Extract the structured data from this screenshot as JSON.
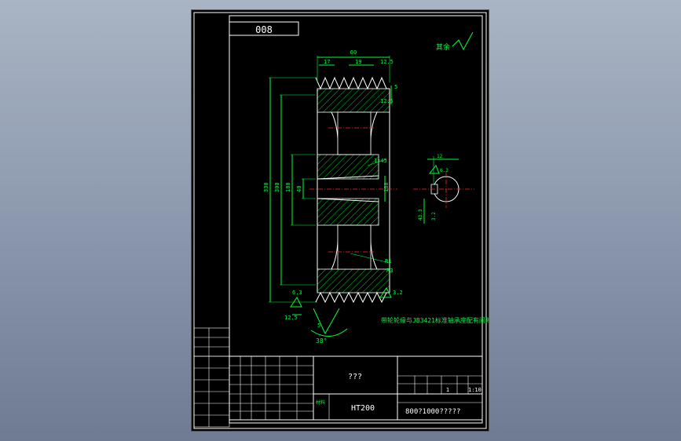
{
  "drawing": {
    "part_code": "008",
    "roughness_note": "其余",
    "technical_note": "带轮轮缘与JB3421标准轴承座配有间隙",
    "angle_label": "38°",
    "dims": {
      "top_overall": "60",
      "top_left": "17",
      "top_mid": "19",
      "top_right": "12.5",
      "flange_right": "12.5",
      "groove_r": "5",
      "bore_chamfer": "1×45",
      "bore_dia": "180",
      "left_d1": "330",
      "left_d2": "300",
      "left_d3": "180",
      "left_bore": "40",
      "roughness_top": "12.5",
      "roughness_bot": "12.5",
      "fillet": "R1",
      "bottom_note": "6.3",
      "hub_r1": "R3",
      "key_width": "12",
      "key_roughness": "6.3",
      "key_depth": "43.3",
      "key_tol": "3.2",
      "key_chord": "12.5",
      "side_note": "3.2"
    }
  },
  "title_block": {
    "drawing_name": "???",
    "material": "HT200",
    "drawing_number": "800?1000?????",
    "sheet_count": "1",
    "scale": "1:10",
    "label_material_row": "材料",
    "label_count": "数量",
    "label_scale": "比例"
  }
}
